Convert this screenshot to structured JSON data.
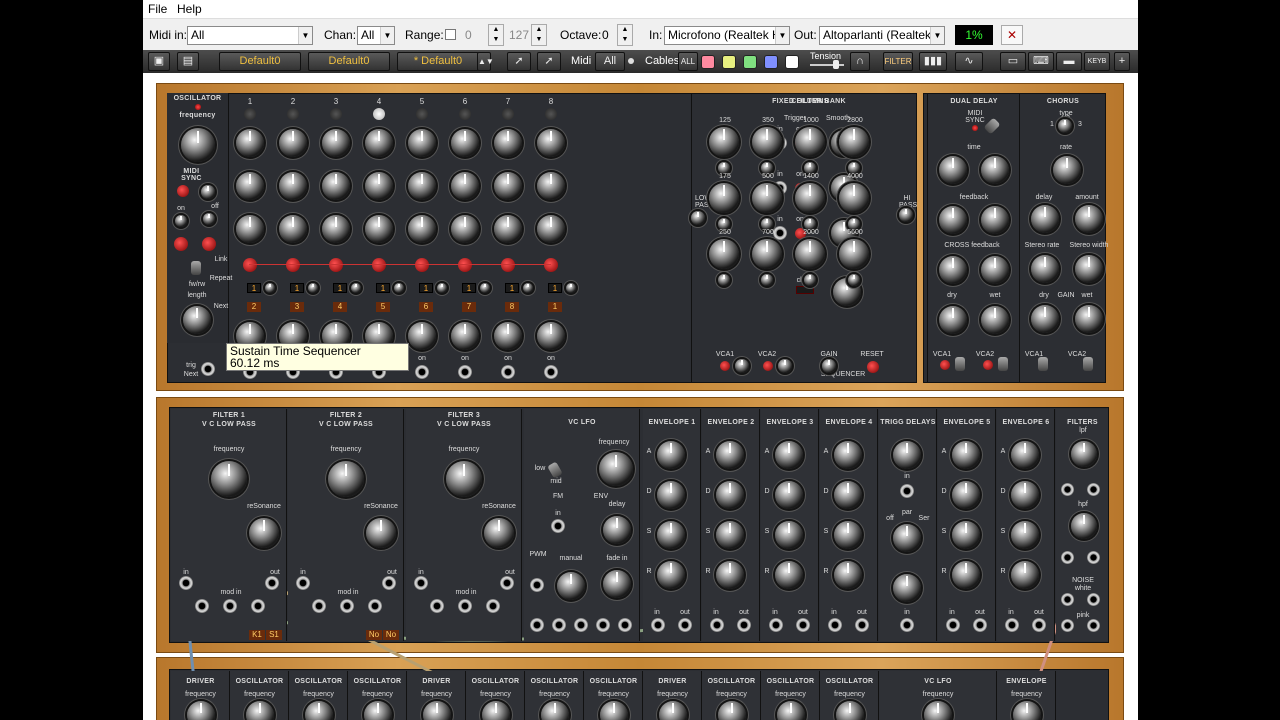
{
  "menu": {
    "file": "File",
    "help": "Help"
  },
  "midibar": {
    "midi_in_label": "Midi in:",
    "midi_in_value": "All",
    "chan_label": "Chan:",
    "chan_value": "All",
    "range_label": "Range:",
    "range_low": "0",
    "range_high": "127",
    "octave_label": "Octave:",
    "octave_value": "0",
    "in_label": "In:",
    "in_value": "Microfono (Realtek Hig",
    "out_label": "Out:",
    "out_value": "Altoparlanti (Realtek H",
    "cpu_value": "1%"
  },
  "toolbar": {
    "preset1": "Default0",
    "preset2": "Default0",
    "preset3": "* Default0",
    "midi_label": "Midi",
    "midi_value": "All",
    "cables_label": "Cables",
    "cables_value": "ALL",
    "tension_label": "Tension",
    "filter_label": "FILTER",
    "keyb_label": "KEYB",
    "cable_colors": [
      "#ff8aa0",
      "#e8f080",
      "#80e080",
      "#8090ff",
      "#ffffff"
    ]
  },
  "top_rack": {
    "oscillator": {
      "title": "OSCILLATOR",
      "frequency": "frequency",
      "midi_sync": "MIDI SYNC",
      "on": "on",
      "off": "off",
      "fwrw": "fw/rw",
      "length": "length",
      "trig": "trig",
      "next": "Next"
    },
    "sequencer": {
      "step_numbers": [
        "1",
        "2",
        "3",
        "4",
        "5",
        "6",
        "7",
        "8"
      ],
      "link": "Link",
      "repeat": "Repeat",
      "next": "Next",
      "repeat_values": [
        "1",
        "1",
        "1",
        "1",
        "1",
        "1",
        "1",
        "1"
      ],
      "next_values": [
        "2",
        "3",
        "4",
        "5",
        "6",
        "7",
        "8",
        "1"
      ],
      "on": "on",
      "columns_title": "COLUMNS",
      "trigger": "Trigger",
      "smooth": "Smooth",
      "in": "in",
      "chain": "chain",
      "sequencer_label": "SEQUENCER"
    },
    "filter_bank": {
      "title": "FIXED FILTER BANK",
      "low_pass": "LOW PASS",
      "hi_pass": "HI PASS",
      "bands": [
        "125",
        "350",
        "1000",
        "2800",
        "175",
        "500",
        "1400",
        "4000",
        "250",
        "700",
        "2000",
        "5600"
      ],
      "vca1": "VCA1",
      "vca2": "VCA2",
      "gain": "GAIN",
      "reset": "RESET"
    },
    "dual_delay": {
      "title": "DUAL DELAY",
      "midi_sync": "MIDI SYNC",
      "time": "time",
      "feedback": "feedback",
      "cross_feedback": "CROSS feedback",
      "dry": "dry",
      "wet": "wet",
      "vca1": "VCA1",
      "vca2": "VCA2"
    },
    "chorus": {
      "title": "CHORUS",
      "type": "type",
      "type_values": [
        "1",
        "2",
        "3"
      ],
      "rate": "rate",
      "delay": "delay",
      "amount": "amount",
      "stereo_rate": "Stereo rate",
      "stereo_width": "Stereo width",
      "dry": "dry",
      "gain": "GAIN",
      "wet": "wet",
      "vca1": "VCA1",
      "vca2": "VCA2"
    }
  },
  "tooltip": {
    "title": "Sustain Time Sequencer",
    "value": "60.12 ms"
  },
  "mid_rack": {
    "filters": [
      {
        "title": "FILTER 1",
        "sub": "V C LOW PASS",
        "frequency": "frequency",
        "resonance": "reSonance",
        "in": "in",
        "mod_in": "mod in",
        "out": "out",
        "badges": [
          "K1",
          "S1"
        ]
      },
      {
        "title": "FILTER 2",
        "sub": "V C LOW PASS",
        "frequency": "frequency",
        "resonance": "reSonance",
        "in": "in",
        "mod_in": "mod in",
        "out": "out",
        "badges": [
          "No",
          "No"
        ]
      },
      {
        "title": "FILTER 3",
        "sub": "V C LOW PASS",
        "frequency": "frequency",
        "resonance": "reSonance",
        "in": "in",
        "mod_in": "mod in",
        "out": "out",
        "badges": []
      }
    ],
    "vclfo": {
      "title": "VC LFO",
      "frequency": "frequency",
      "low": "low",
      "mid": "mid",
      "fm": "FM",
      "in": "in",
      "pwm": "PWM",
      "manual": "manual",
      "env": "ENV",
      "delay": "delay",
      "fade_in": "fade in"
    },
    "envelopes": [
      "ENVELOPE 1",
      "ENVELOPE 2",
      "ENVELOPE 3",
      "ENVELOPE 4"
    ],
    "adsr": [
      "A",
      "D",
      "S",
      "R"
    ],
    "trigg": {
      "title": "TRIGG DELAYS",
      "in": "in",
      "off": "off",
      "par": "par",
      "ser": "Ser"
    },
    "envelopes2": [
      "ENVELOPE 5",
      "ENVELOPE 6"
    ],
    "filters_mod": {
      "title": "FILTERS",
      "lpf": "lpf",
      "hpf": "hpf",
      "noise": "NOISE",
      "white": "white",
      "pink": "pink",
      "in": "in",
      "out": "out"
    }
  },
  "bottom_rack": {
    "titles": [
      "DRIVER",
      "OSCILLATOR",
      "OSCILLATOR",
      "OSCILLATOR",
      "DRIVER",
      "OSCILLATOR",
      "OSCILLATOR",
      "OSCILLATOR",
      "DRIVER",
      "OSCILLATOR",
      "OSCILLATOR",
      "OSCILLATOR",
      "VC LFO",
      "ENVELOPE",
      "ENVELOPE"
    ],
    "frequency": "frequency"
  }
}
